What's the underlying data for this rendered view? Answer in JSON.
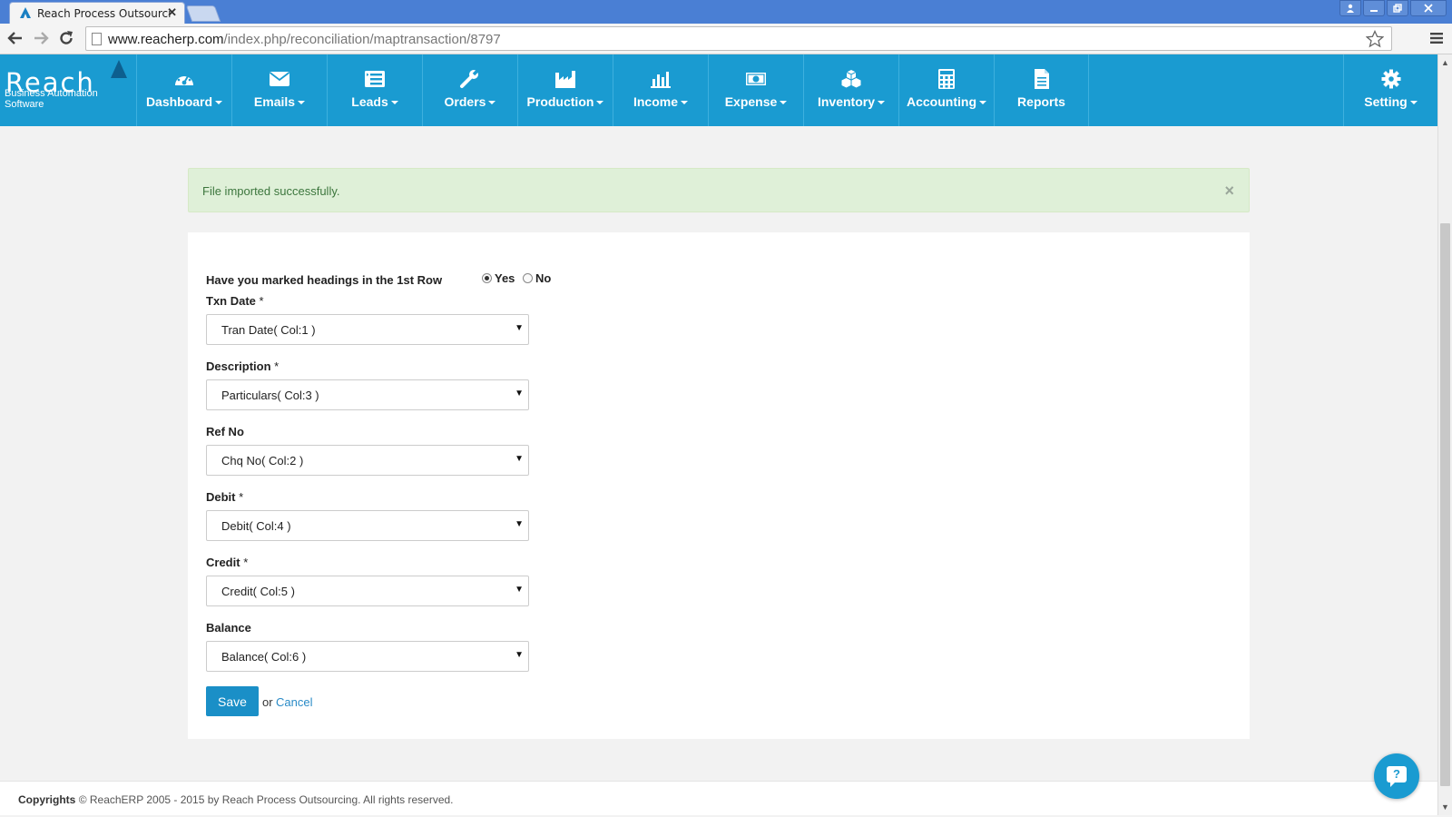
{
  "browser": {
    "tab_title": "Reach Process Outsourcing",
    "close_glyph": "✕",
    "url_host": "www.reacherp.com",
    "url_path": "/index.php/reconciliation/maptransaction/8797"
  },
  "brand": {
    "name": "Reach",
    "tagline": "Business Automation Software"
  },
  "nav": {
    "items": [
      {
        "label": "Dashboard",
        "icon": "dashboard-icon",
        "dropdown": true
      },
      {
        "label": "Emails",
        "icon": "envelope-icon",
        "dropdown": true
      },
      {
        "label": "Leads",
        "icon": "list-icon",
        "dropdown": true
      },
      {
        "label": "Orders",
        "icon": "wrench-icon",
        "dropdown": true
      },
      {
        "label": "Production",
        "icon": "factory-icon",
        "dropdown": true
      },
      {
        "label": "Income",
        "icon": "bar-chart-icon",
        "dropdown": true
      },
      {
        "label": "Expense",
        "icon": "money-icon",
        "dropdown": true
      },
      {
        "label": "Inventory",
        "icon": "cubes-icon",
        "dropdown": true
      },
      {
        "label": "Accounting",
        "icon": "calculator-icon",
        "dropdown": true
      },
      {
        "label": "Reports",
        "icon": "document-icon",
        "dropdown": false
      }
    ],
    "setting_label": "Setting"
  },
  "alert": {
    "message": "File imported successfully.",
    "close": "×"
  },
  "form": {
    "heading_question": "Have you marked headings in the 1st Row",
    "radio_yes": "Yes",
    "radio_no": "No",
    "selected_radio": "Yes",
    "fields": [
      {
        "label": "Txn Date",
        "required": "*",
        "value": "Tran Date( Col:1 )"
      },
      {
        "label": "Description",
        "required": "*",
        "value": "Particulars( Col:3 )"
      },
      {
        "label": "Ref No",
        "required": "",
        "value": "Chq No( Col:2 )"
      },
      {
        "label": "Debit",
        "required": "*",
        "value": "Debit( Col:4 )"
      },
      {
        "label": "Credit",
        "required": "*",
        "value": "Credit( Col:5 )"
      },
      {
        "label": "Balance",
        "required": "",
        "value": "Balance( Col:6 )"
      }
    ],
    "save_label": "Save",
    "or_text": "or",
    "cancel_label": "Cancel"
  },
  "footer": {
    "copyright_label": "Copyrights",
    "copyright_text": "© ReachERP 2005 - 2015 by Reach Process Outsourcing. All rights reserved."
  },
  "help": {
    "glyph": "?"
  },
  "colors": {
    "nav_bg": "#1a9bd1",
    "alert_bg": "#dff0d8",
    "save_bg": "#1a8fc7"
  }
}
